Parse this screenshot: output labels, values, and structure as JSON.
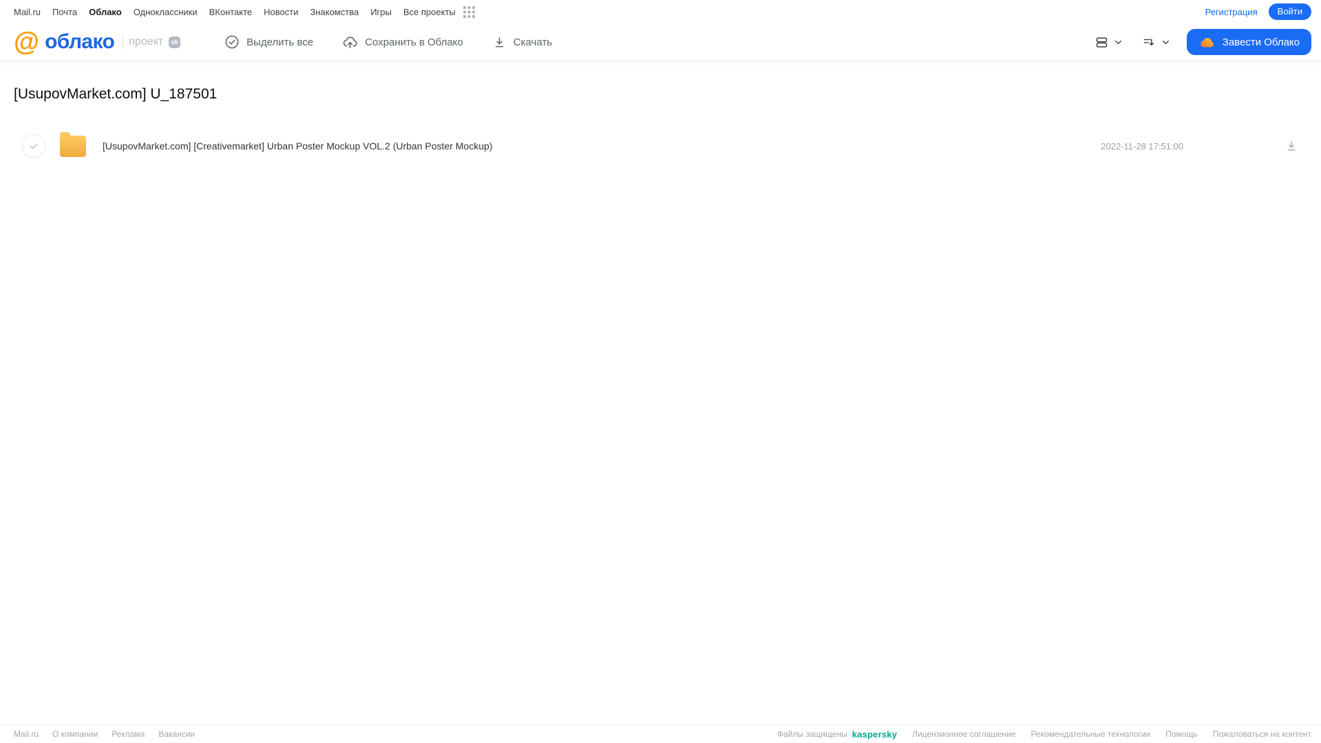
{
  "top_nav": {
    "links": [
      "Mail.ru",
      "Почта",
      "Облако",
      "Одноклассники",
      "ВКонтакте",
      "Новости",
      "Знакомства",
      "Игры",
      "Все проекты"
    ],
    "active_link": "Облако",
    "registration": "Регистрация",
    "login": "Войти"
  },
  "header": {
    "logo_text": "облако",
    "project_label": "проект",
    "vk_badge": "vk",
    "toolbar": {
      "select_all": "Выделить все",
      "save_to_cloud": "Сохранить в Облако",
      "download": "Скачать"
    },
    "get_cloud_button": "Завести Облако"
  },
  "page": {
    "title": "[UsupovMarket.com] U_187501"
  },
  "files": [
    {
      "type": "folder",
      "name": "[UsupovMarket.com] [Creativemarket] Urban Poster Mockup VOL.2 (Urban Poster Mockup)",
      "date": "2022-11-28 17:51:00"
    }
  ],
  "footer": {
    "links_left": [
      "Mail.ru",
      "О компании",
      "Реклама",
      "Вакансии"
    ],
    "protected_label": "Файлы защищены",
    "protected_brand": "kaspersky",
    "links_right": [
      "Лицензионное соглашение",
      "Рекомендательные технологии",
      "Помощь",
      "Пожаловаться на контент"
    ]
  },
  "icons": {
    "logo": "at-sign",
    "all_projects": "grid-dots",
    "select_all": "check-circle",
    "save_to_cloud": "cloud-upload",
    "download": "arrow-down-underline",
    "view_mode": "rows-view",
    "sort": "sort-descending",
    "dropdown": "chevron-down",
    "get_cloud": "cloud-solid",
    "file": "folder",
    "row_selected": "check-circle",
    "row_download": "arrow-down-underline"
  },
  "colors": {
    "accent_blue": "#1b6cf5",
    "logo_blue": "#1c68e0",
    "logo_orange": "#ff9e00",
    "folder_yellow": "#f7b84e",
    "kaspersky_teal": "#00a88e",
    "toolbar_gray": "#5a6468",
    "muted_gray": "#9aa0a6"
  }
}
